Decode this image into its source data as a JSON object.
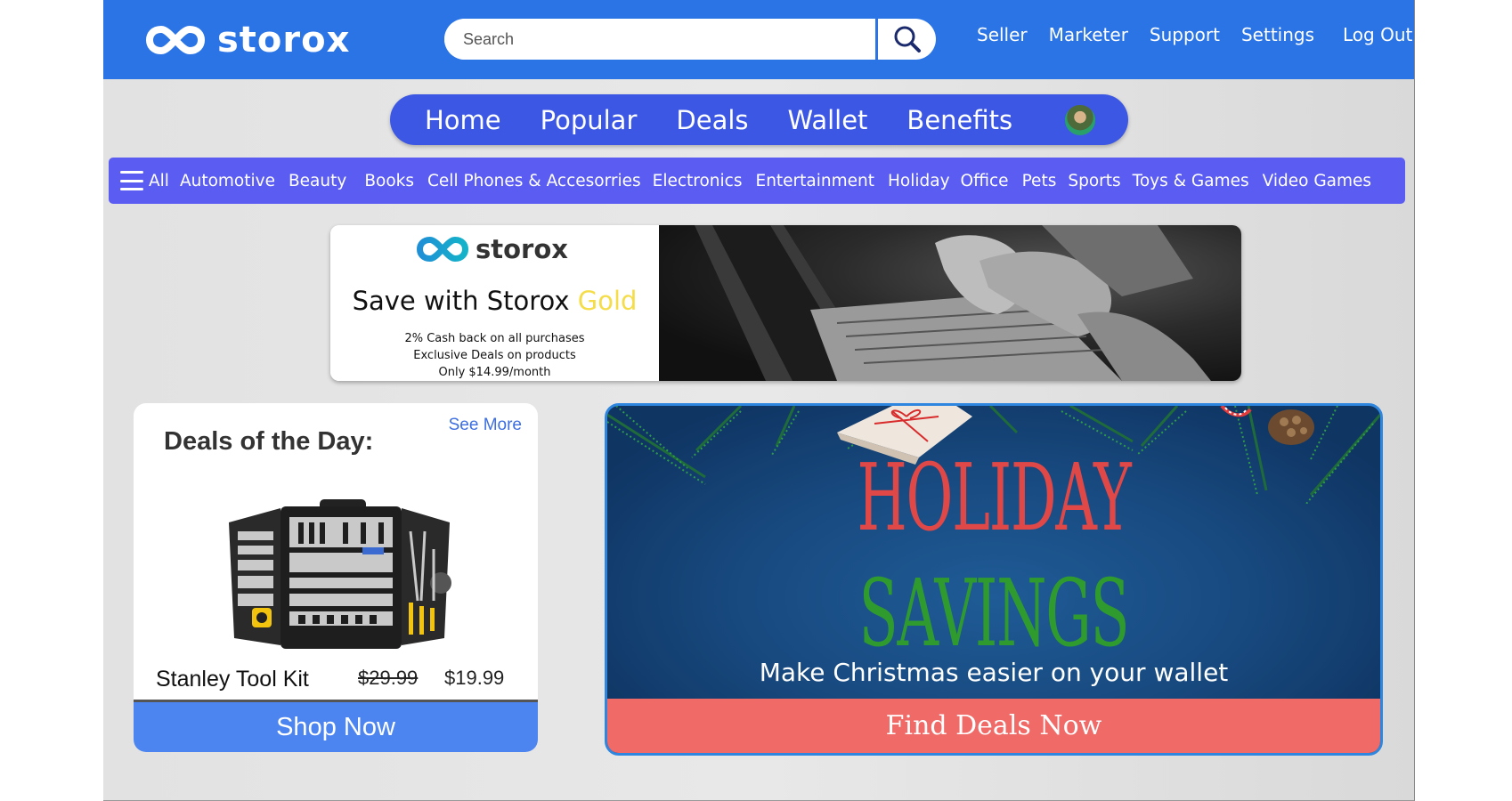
{
  "brand": {
    "name": "storox",
    "color": "#2a74e6"
  },
  "search": {
    "placeholder": "Search"
  },
  "top_links": [
    "Seller",
    "Marketer",
    "Support",
    "Settings",
    "Log Out"
  ],
  "main_nav": [
    "Home",
    "Popular",
    "Deals",
    "Wallet",
    "Benefits"
  ],
  "categories": {
    "all_label": "All",
    "items": [
      "Automotive",
      "Beauty",
      "Books",
      "Cell Phones & Accesorries",
      "Electronics",
      "Entertainment",
      "Holiday",
      "Office",
      "Pets",
      "Sports",
      "Toys & Games",
      "Video Games"
    ]
  },
  "gold_banner": {
    "logo_text": "storox",
    "headline_prefix": "Save with Storox ",
    "headline_highlight": "Gold",
    "lines": [
      "2% Cash back on all purchases",
      "Exclusive Deals on products",
      "Only $14.99/month"
    ]
  },
  "deals": {
    "title": "Deals of the Day:",
    "see_more": "See More",
    "product_name": "Stanley Tool Kit",
    "old_price": "$29.99",
    "new_price": "$19.99",
    "cta": "Shop Now"
  },
  "holiday": {
    "title_line1": "HOLIDAY",
    "title_line2": "SAVINGS",
    "subtitle": "Make Christmas easier on your wallet",
    "cta": "Find Deals Now"
  },
  "colors": {
    "nav_pill": "#3b57e4",
    "category_bar": "#5a5cf2",
    "shop_now": "#4c84f0",
    "find_deals": "#f06a68",
    "holiday_red": "#e04848",
    "holiday_green": "#2f9b2f"
  }
}
